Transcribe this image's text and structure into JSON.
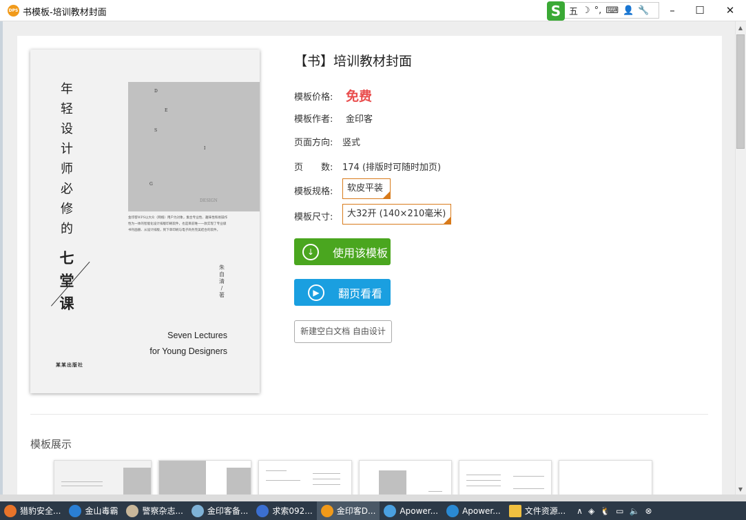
{
  "window": {
    "app_icon": "DPS",
    "title": "书模板-培训教材封面",
    "ime": {
      "logo": "S",
      "items": [
        "五",
        "☽",
        "°,",
        "⌨",
        "👤",
        "🔧"
      ]
    },
    "controls": {
      "minimize": "–",
      "maximize": "☐",
      "close": "✕"
    }
  },
  "cover": {
    "title_chars": [
      "年",
      "轻",
      "设",
      "计",
      "师",
      "必",
      "修",
      "的"
    ],
    "title_big": [
      "七",
      "堂",
      "课"
    ],
    "design_letters": [
      "D",
      "E",
      "S",
      "I",
      "G"
    ],
    "design_word": "DESIGN",
    "blurb": "金印客WPS以大众（网络）用户为对象，集合专业性、趣味性和易操作性为一体的智能化设计排版印刷软件，也是目前唯一一款实现了专业级书刊画册、从设计排版，到下单印刷与电子商务完美结合的软件。",
    "author": [
      "朱",
      "自",
      "清",
      "/",
      "著"
    ],
    "english": [
      "Seven Lectures",
      "for Young Designers"
    ],
    "publisher": "某某出版社"
  },
  "info": {
    "title": "【书】培训教材封面",
    "price_label": "模板价格:",
    "price": "免费",
    "author_label": "模板作者:",
    "author": "金印客",
    "orientation_label": "页面方向:",
    "orientation": "竖式",
    "pages_label": "页　　数:",
    "pages": "174 (排版时可随时加页)",
    "spec_label": "模板规格:",
    "spec": "软皮平装",
    "size_label": "模板尺寸:",
    "size": "大32开 (140×210毫米)"
  },
  "buttons": {
    "use": "使用该模板",
    "flip": "翻页看看",
    "new_blank": "新建空白文档 自由设计"
  },
  "showcase": {
    "title": "模板展示"
  },
  "taskbar": {
    "items": [
      {
        "label": "猎豹安全...",
        "color": "#e8742a"
      },
      {
        "label": "金山毒霸",
        "color": "#2a7fd4"
      },
      {
        "label": "警察杂志...",
        "color": "#c9b79a"
      },
      {
        "label": "金印客备...",
        "color": "#7fb2d6"
      },
      {
        "label": "求索092...",
        "color": "#3b6fd1"
      },
      {
        "label": "金印客D...",
        "color": "#f19a1a"
      },
      {
        "label": "Apower...",
        "color": "#4aa0e0"
      },
      {
        "label": "Apower...",
        "color": "#2a8ad4"
      },
      {
        "label": "文件资源...",
        "color": "#f0c040"
      }
    ],
    "tray": [
      "∧",
      "◈",
      "🐧",
      "▭",
      "🔈",
      "⊗"
    ]
  }
}
